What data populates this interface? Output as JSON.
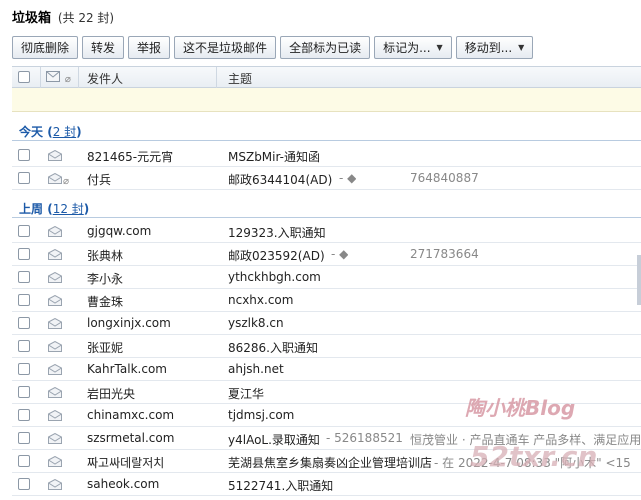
{
  "folder": {
    "name": "垃圾箱",
    "count_text": "(共 22 封)"
  },
  "toolbar": {
    "delete_forever": "彻底删除",
    "forward": "转发",
    "report": "举报",
    "not_spam": "这不是垃圾邮件",
    "mark_all_read": "全部标为已读",
    "mark_as": "标记为...",
    "move_to": "移动到..."
  },
  "columns": {
    "sender": "发件人",
    "subject": "主题"
  },
  "groups": [
    {
      "label": "今天",
      "count": "2 封",
      "rows": [
        {
          "sender": "821465-元元宵",
          "subject": "MSZbMir-通知函",
          "extra": "",
          "attach": false
        },
        {
          "sender": "付兵",
          "subject": "邮政6344104(AD)",
          "extra": "-  ◆",
          "extra2": "764840887",
          "attach": true
        }
      ]
    },
    {
      "label": "上周",
      "count": "12 封",
      "rows": [
        {
          "sender": "gjgqw.com",
          "subject": "129323.入职通知",
          "extra": "",
          "attach": false
        },
        {
          "sender": "张典林",
          "subject": "邮政023592(AD)",
          "extra": "-  ◆",
          "extra2": "271783664",
          "attach": false
        },
        {
          "sender": "李小永",
          "subject": "ythckhbgh.com",
          "extra": "",
          "attach": false
        },
        {
          "sender": "曹金珠",
          "subject": "ncxhx.com",
          "extra": "",
          "attach": false
        },
        {
          "sender": "longxinjx.com",
          "subject": "yszlk8.cn",
          "extra": "",
          "attach": false
        },
        {
          "sender": "张亚妮",
          "subject": "86286.入职通知",
          "extra": "",
          "attach": false
        },
        {
          "sender": "KahrTalk.com",
          "subject": "ahjsh.net",
          "extra": "",
          "attach": false
        },
        {
          "sender": "岩田光央",
          "subject": "夏江华",
          "extra": "",
          "attach": false
        },
        {
          "sender": "chinamxc.com",
          "subject": "tjdmsj.com",
          "extra": "",
          "attach": false
        },
        {
          "sender": "szsrmetal.com",
          "subject": "y4lAoL.录取通知",
          "extra": "- 526188521",
          "extra2": "恒茂管业 · 产品直通车 产品多样、满足应用场",
          "attach": false
        },
        {
          "sender": "짜고싸데랄저치",
          "subject": "芜湖县焦室乡集扇奏凶企业管理培训店",
          "extra": "- 在 2022-4-7  08:33  \"阿小木\" <15",
          "attach": false
        },
        {
          "sender": "saheok.com",
          "subject": "5122741.入职通知",
          "extra": "",
          "attach": false
        }
      ]
    }
  ],
  "watermark": {
    "line1": "陶小桃Blog",
    "line2": "52txr.cn"
  }
}
